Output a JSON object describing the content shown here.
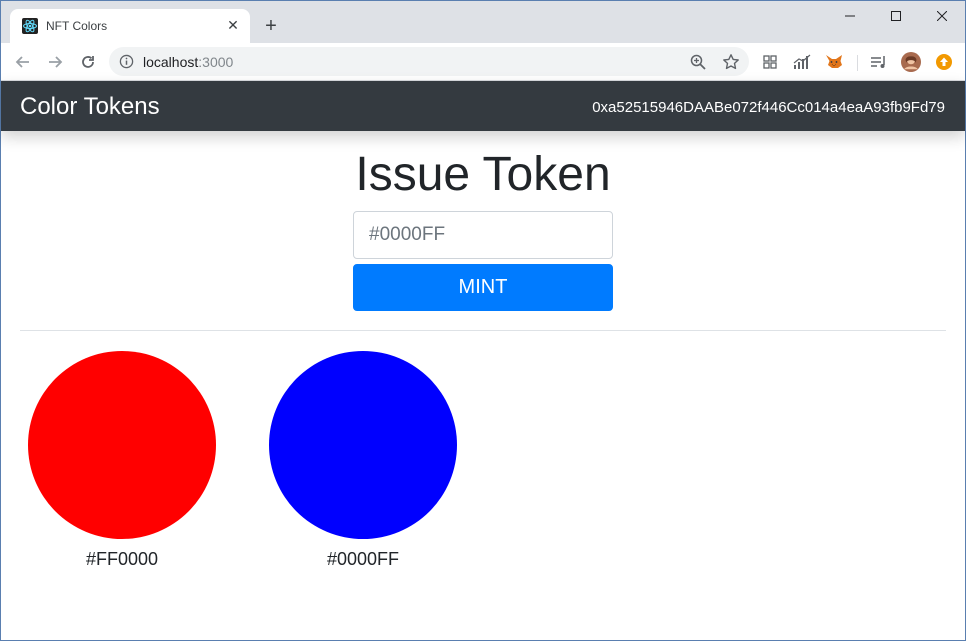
{
  "browser": {
    "tab_title": "NFT Colors",
    "url_host": "localhost",
    "url_port": ":3000"
  },
  "navbar": {
    "brand": "Color Tokens",
    "account": "0xa52515946DAABe072f446Cc014a4eaA93fb9Fd79"
  },
  "main": {
    "heading": "Issue Token",
    "input_placeholder": "#0000FF",
    "mint_label": "MINT"
  },
  "tokens": [
    {
      "color": "#FF0000",
      "label": "#FF0000"
    },
    {
      "color": "#0000FF",
      "label": "#0000FF"
    }
  ],
  "icons": {
    "favicon": "react-icon",
    "zoom": "zoom-icon",
    "bookmark": "star-icon",
    "extensions": [
      "grid-icon",
      "signal-icon",
      "metamask-fox-icon",
      "media-icon",
      "profile-avatar",
      "update-icon"
    ]
  },
  "colors": {
    "navbar_bg": "#343a40",
    "primary": "#007bff",
    "heading_text": "#212529"
  }
}
